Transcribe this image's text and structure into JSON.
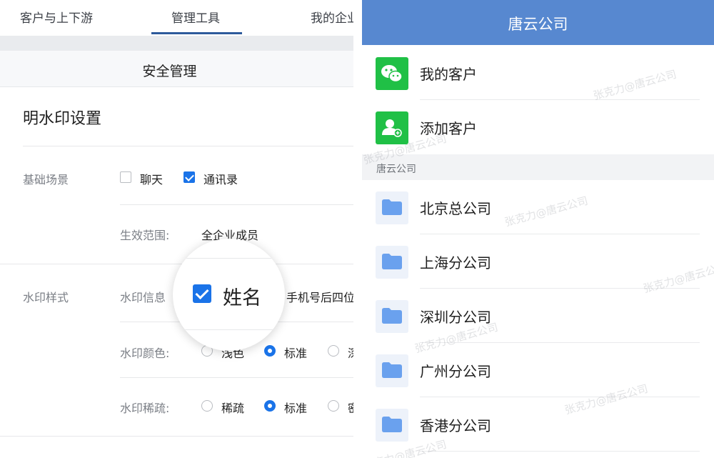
{
  "left": {
    "tabs": [
      {
        "label": "客户与上下游"
      },
      {
        "label": "管理工具"
      },
      {
        "label": "我的企业"
      }
    ],
    "section_title": "安全管理",
    "form_title": "明水印设置",
    "scene": {
      "label": "基础场景",
      "options": [
        {
          "label": "聊天",
          "checked": false
        },
        {
          "label": "通讯录",
          "checked": true
        }
      ]
    },
    "scope": {
      "label": "生效范围:",
      "value": "全企业成员"
    },
    "style": {
      "label": "水印样式"
    },
    "info": {
      "label": "水印信息",
      "value_suffix": "手机号后四位"
    },
    "magnifier": {
      "label": "姓名",
      "checked": true
    },
    "color": {
      "label": "水印颜色:",
      "options": [
        {
          "label": "浅色",
          "selected": false
        },
        {
          "label": "标准",
          "selected": true
        },
        {
          "label": "深色",
          "selected": false
        }
      ]
    },
    "density": {
      "label": "水印稀疏:",
      "options": [
        {
          "label": "稀疏",
          "selected": false
        },
        {
          "label": "标准",
          "selected": true
        },
        {
          "label": "密集",
          "selected": false
        }
      ]
    }
  },
  "right": {
    "title": "唐云公司",
    "header_color": "#5788d0",
    "top_items": [
      {
        "label": "我的客户",
        "icon": "wechat-icon"
      },
      {
        "label": "添加客户",
        "icon": "add-contact-icon"
      }
    ],
    "group_label": "唐云公司",
    "departments": [
      {
        "label": "北京总公司",
        "icon": "folder-icon"
      },
      {
        "label": "上海分公司",
        "icon": "folder-icon"
      },
      {
        "label": "深圳分公司",
        "icon": "folder-icon"
      },
      {
        "label": "广州分公司",
        "icon": "folder-icon"
      },
      {
        "label": "香港分公司",
        "icon": "folder-icon"
      }
    ],
    "watermark_text": "张克力@唐云公司"
  },
  "colors": {
    "accent": "#1a73e8",
    "tab_underline": "#2d5a9b",
    "green_icon": "#20c046",
    "folder_icon": "#6aa1ee"
  }
}
